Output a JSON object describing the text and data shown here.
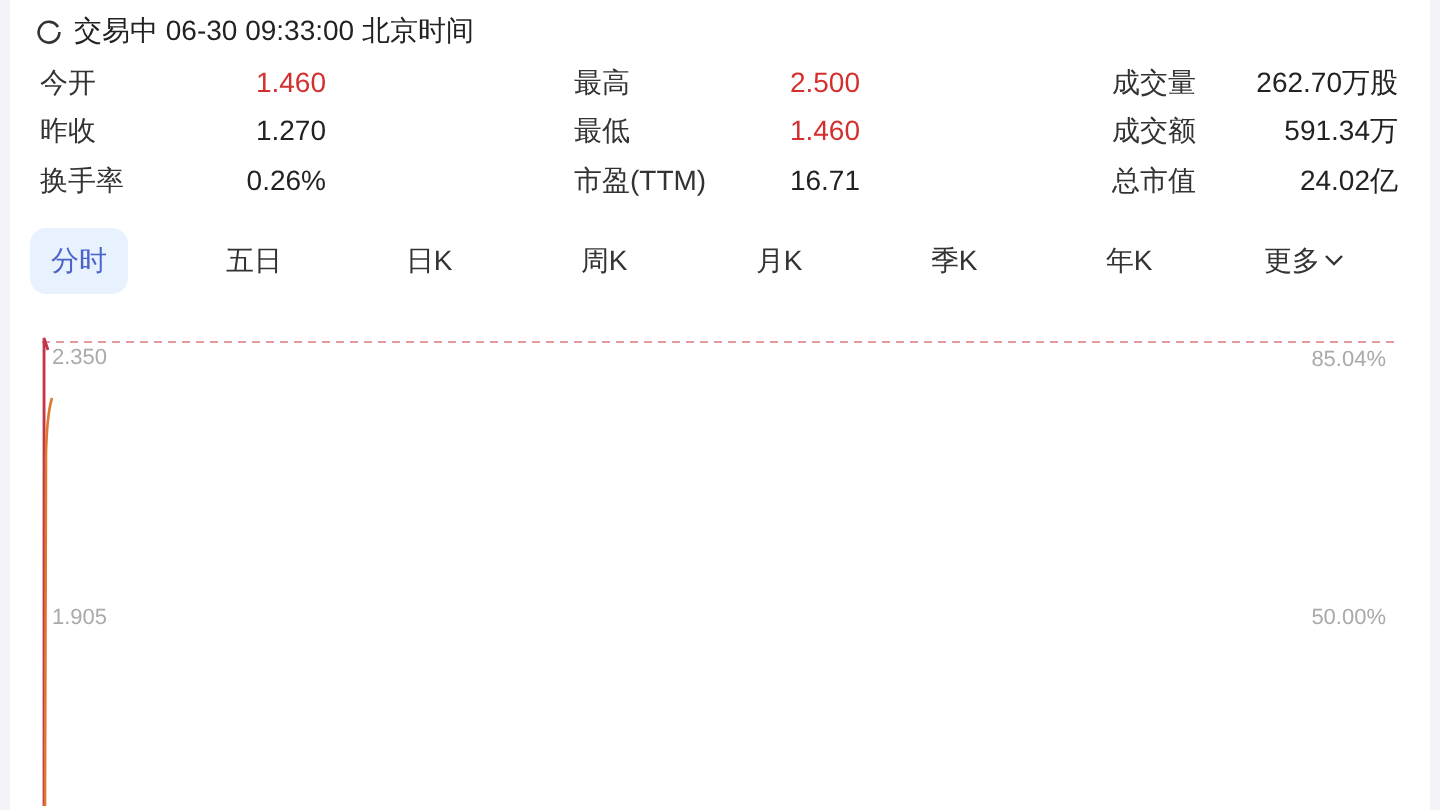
{
  "status": {
    "text": "交易中 06-30 09:33:00 北京时间"
  },
  "stats": [
    {
      "label": "今开",
      "value": "1.460",
      "color": "#d32f2f"
    },
    {
      "label": "最高",
      "value": "2.500",
      "color": "#d32f2f"
    },
    {
      "label": "成交量",
      "value": "262.70万股",
      "color": "#222222"
    },
    {
      "label": "昨收",
      "value": "1.270",
      "color": "#222222"
    },
    {
      "label": "最低",
      "value": "1.460",
      "color": "#d32f2f"
    },
    {
      "label": "成交额",
      "value": "591.34万",
      "color": "#222222"
    },
    {
      "label": "换手率",
      "value": "0.26%",
      "color": "#222222"
    },
    {
      "label": "市盈(TTM)",
      "value": "16.71",
      "color": "#222222"
    },
    {
      "label": "总市值",
      "value": "24.02亿",
      "color": "#222222"
    }
  ],
  "tabs": [
    {
      "label": "分时",
      "selected": true
    },
    {
      "label": "五日",
      "selected": false
    },
    {
      "label": "日K",
      "selected": false
    },
    {
      "label": "周K",
      "selected": false
    },
    {
      "label": "月K",
      "selected": false
    },
    {
      "label": "季K",
      "selected": false
    },
    {
      "label": "年K",
      "selected": false
    },
    {
      "label": "更多",
      "selected": false,
      "dropdown": true
    }
  ],
  "chart": {
    "price_labels": [
      "2.350",
      "1.905"
    ],
    "percent_labels": [
      "85.04%",
      "50.00%"
    ]
  }
}
